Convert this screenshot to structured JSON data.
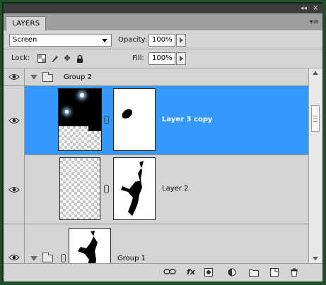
{
  "panel": {
    "tab_label": "LAYERS",
    "collapse_glyph": "◂◂",
    "close_glyph": "✕",
    "menu_glyph": "▾≡"
  },
  "controls": {
    "blend_mode": "Screen",
    "opacity_label": "Opacity:",
    "opacity_value": "100%",
    "lock_label": "Lock:",
    "fill_label": "Fill:",
    "fill_value": "100%"
  },
  "layers": [
    {
      "name": "Group 2",
      "kind": "group",
      "expanded": true,
      "visible": true,
      "selected": false
    },
    {
      "name": "Layer 3 copy",
      "kind": "layer",
      "visible": true,
      "selected": true
    },
    {
      "name": "Layer 2",
      "kind": "layer",
      "visible": true,
      "selected": false
    },
    {
      "name": "Group 1",
      "kind": "group",
      "expanded": true,
      "visible": true,
      "selected": false
    }
  ],
  "footer_icons": [
    "link-layers-icon",
    "fx-icon",
    "add-mask-icon",
    "adjustment-layer-icon",
    "new-group-icon",
    "new-layer-icon",
    "trash-icon"
  ],
  "glyphs": {
    "fx": "fx",
    "lock_move": "✥"
  },
  "colors": {
    "selection": "#3399ff",
    "panel_bg": "#d4d4d4",
    "frame": "#1f4f28"
  }
}
